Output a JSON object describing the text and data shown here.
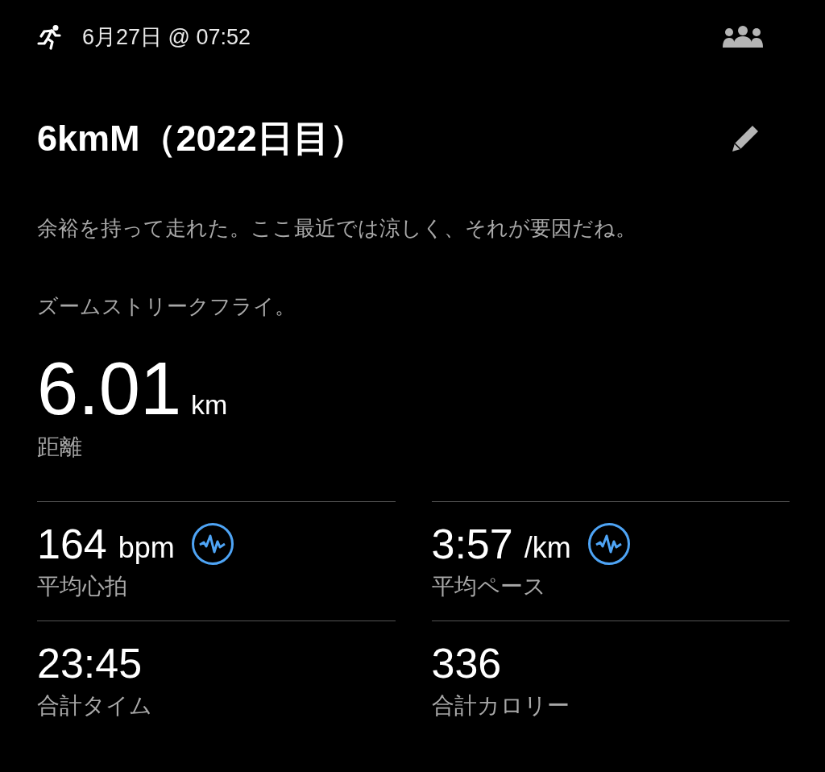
{
  "header": {
    "datetime": "6月27日 @ 07:52"
  },
  "title": "6kmM（2022日目）",
  "notes": [
    "余裕を持って走れた。ここ最近では涼しく、それが要因だね。",
    "ズームストリークフライ。"
  ],
  "distance": {
    "value": "6.01",
    "unit": "km",
    "label": "距離"
  },
  "stats": [
    {
      "value": "164",
      "unit": "bpm",
      "label": "平均心拍",
      "kind": "graph"
    },
    {
      "value": "3:57",
      "unit": "/km",
      "label": "平均ペース",
      "kind": "graph"
    },
    {
      "value": "23:45",
      "label": "合計タイム",
      "kind": "plain"
    },
    {
      "value": "336",
      "label": "合計カロリー",
      "kind": "plain"
    }
  ]
}
